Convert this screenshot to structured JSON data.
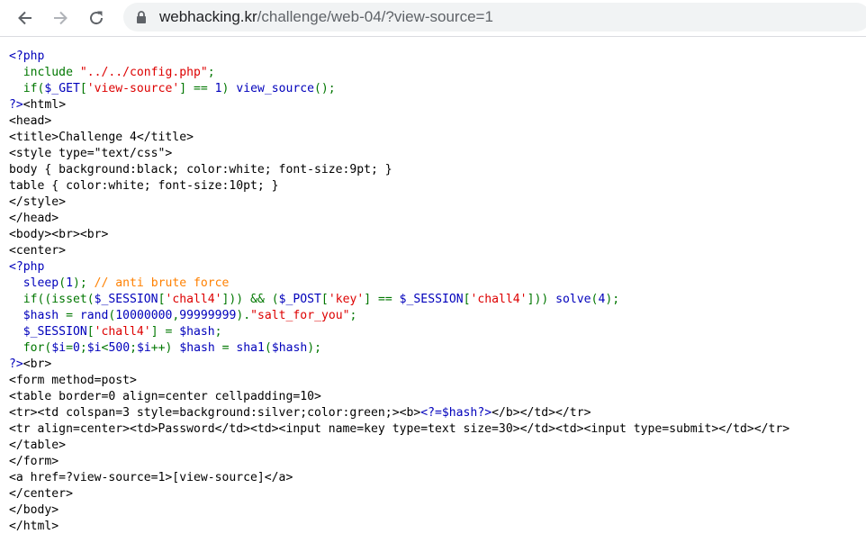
{
  "browser": {
    "back_icon": "arrow-left-icon",
    "forward_icon": "arrow-right-icon",
    "reload_icon": "reload-icon",
    "lock_icon": "lock-icon",
    "url_host": "webhacking.kr",
    "url_path": "/challenge/web-04/?view-source=1"
  },
  "source": {
    "lines": [
      [
        {
          "t": "<?php",
          "c": "tag"
        }
      ],
      [
        {
          "t": "  include ",
          "c": "inc"
        },
        {
          "t": "\"../../config.php\"",
          "c": "str"
        },
        {
          "t": ";",
          "c": "inc"
        }
      ],
      [
        {
          "t": "  if(",
          "c": "inc"
        },
        {
          "t": "$_GET",
          "c": "kw"
        },
        {
          "t": "[",
          "c": "inc"
        },
        {
          "t": "'view-source'",
          "c": "str"
        },
        {
          "t": "] == ",
          "c": "inc"
        },
        {
          "t": "1",
          "c": "kw"
        },
        {
          "t": ") ",
          "c": "inc"
        },
        {
          "t": "view_source",
          "c": "kw"
        },
        {
          "t": "();",
          "c": "inc"
        }
      ],
      [
        {
          "t": "?>",
          "c": "tag"
        },
        {
          "t": "<html>",
          "c": ""
        }
      ],
      [
        {
          "t": "<head>",
          "c": ""
        }
      ],
      [
        {
          "t": "<title>Challenge 4</title>",
          "c": ""
        }
      ],
      [
        {
          "t": "<style type=\"text/css\">",
          "c": ""
        }
      ],
      [
        {
          "t": "body { background:black; color:white; font-size:9pt; }",
          "c": ""
        }
      ],
      [
        {
          "t": "table { color:white; font-size:10pt; }",
          "c": ""
        }
      ],
      [
        {
          "t": "</style>",
          "c": ""
        }
      ],
      [
        {
          "t": "</head>",
          "c": ""
        }
      ],
      [
        {
          "t": "<body><br><br>",
          "c": ""
        }
      ],
      [
        {
          "t": "<center>",
          "c": ""
        }
      ],
      [
        {
          "t": "<?php",
          "c": "tag"
        }
      ],
      [
        {
          "t": "  sleep",
          "c": "kw"
        },
        {
          "t": "(",
          "c": "inc"
        },
        {
          "t": "1",
          "c": "kw"
        },
        {
          "t": "); ",
          "c": "inc"
        },
        {
          "t": "// anti brute force",
          "c": "cm"
        }
      ],
      [
        {
          "t": "  if((isset(",
          "c": "inc"
        },
        {
          "t": "$_SESSION",
          "c": "kw"
        },
        {
          "t": "[",
          "c": "inc"
        },
        {
          "t": "'chall4'",
          "c": "str"
        },
        {
          "t": "])) && (",
          "c": "inc"
        },
        {
          "t": "$_POST",
          "c": "kw"
        },
        {
          "t": "[",
          "c": "inc"
        },
        {
          "t": "'key'",
          "c": "str"
        },
        {
          "t": "] == ",
          "c": "inc"
        },
        {
          "t": "$_SESSION",
          "c": "kw"
        },
        {
          "t": "[",
          "c": "inc"
        },
        {
          "t": "'chall4'",
          "c": "str"
        },
        {
          "t": "])) ",
          "c": "inc"
        },
        {
          "t": "solve",
          "c": "kw"
        },
        {
          "t": "(",
          "c": "inc"
        },
        {
          "t": "4",
          "c": "kw"
        },
        {
          "t": ");",
          "c": "inc"
        }
      ],
      [
        {
          "t": "  $hash ",
          "c": "kw"
        },
        {
          "t": "= ",
          "c": "inc"
        },
        {
          "t": "rand",
          "c": "kw"
        },
        {
          "t": "(",
          "c": "inc"
        },
        {
          "t": "10000000",
          "c": "kw"
        },
        {
          "t": ",",
          "c": "inc"
        },
        {
          "t": "99999999",
          "c": "kw"
        },
        {
          "t": ").",
          "c": "inc"
        },
        {
          "t": "\"salt_for_you\"",
          "c": "str"
        },
        {
          "t": ";",
          "c": "inc"
        }
      ],
      [
        {
          "t": "  $_SESSION",
          "c": "kw"
        },
        {
          "t": "[",
          "c": "inc"
        },
        {
          "t": "'chall4'",
          "c": "str"
        },
        {
          "t": "] = ",
          "c": "inc"
        },
        {
          "t": "$hash",
          "c": "kw"
        },
        {
          "t": ";",
          "c": "inc"
        }
      ],
      [
        {
          "t": "  for(",
          "c": "inc"
        },
        {
          "t": "$i",
          "c": "kw"
        },
        {
          "t": "=",
          "c": "inc"
        },
        {
          "t": "0",
          "c": "kw"
        },
        {
          "t": ";",
          "c": "inc"
        },
        {
          "t": "$i",
          "c": "kw"
        },
        {
          "t": "<",
          "c": "inc"
        },
        {
          "t": "500",
          "c": "kw"
        },
        {
          "t": ";",
          "c": "inc"
        },
        {
          "t": "$i",
          "c": "kw"
        },
        {
          "t": "++) ",
          "c": "inc"
        },
        {
          "t": "$hash ",
          "c": "kw"
        },
        {
          "t": "= ",
          "c": "inc"
        },
        {
          "t": "sha1",
          "c": "kw"
        },
        {
          "t": "(",
          "c": "inc"
        },
        {
          "t": "$hash",
          "c": "kw"
        },
        {
          "t": ");",
          "c": "inc"
        }
      ],
      [
        {
          "t": "?>",
          "c": "tag"
        },
        {
          "t": "<br>",
          "c": ""
        }
      ],
      [
        {
          "t": "<form method=post>",
          "c": ""
        }
      ],
      [
        {
          "t": "<table border=0 align=center cellpadding=10>",
          "c": ""
        }
      ],
      [
        {
          "t": "<tr><td colspan=3 style=background:silver;color:green;><b>",
          "c": ""
        },
        {
          "t": "<?=",
          "c": "tag"
        },
        {
          "t": "$hash",
          "c": "kw"
        },
        {
          "t": "?>",
          "c": "tag"
        },
        {
          "t": "</b></td></tr>",
          "c": ""
        }
      ],
      [
        {
          "t": "<tr align=center><td>Password</td><td><input name=key type=text size=30></td><td><input type=submit></td></tr>",
          "c": ""
        }
      ],
      [
        {
          "t": "</table>",
          "c": ""
        }
      ],
      [
        {
          "t": "</form>",
          "c": ""
        }
      ],
      [
        {
          "t": "<a href=?view-source=1>[view-source]</a>",
          "c": ""
        }
      ],
      [
        {
          "t": "</center>",
          "c": ""
        }
      ],
      [
        {
          "t": "</body>",
          "c": ""
        }
      ],
      [
        {
          "t": "</html>",
          "c": ""
        }
      ]
    ]
  }
}
